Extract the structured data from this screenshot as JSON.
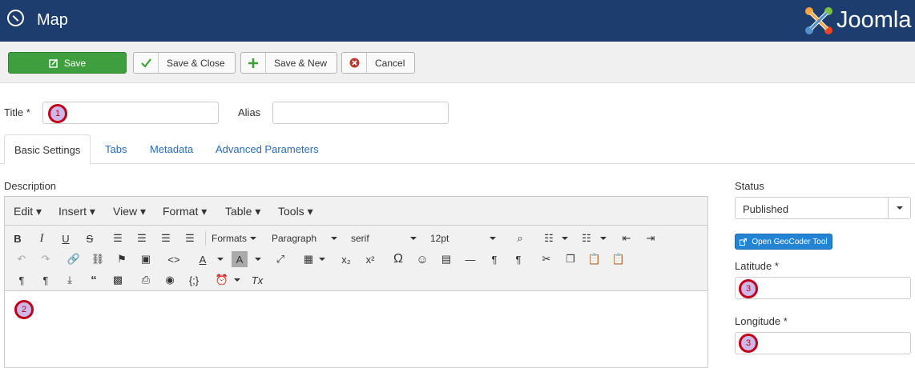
{
  "header": {
    "title": "Map",
    "brand": "Joomla"
  },
  "toolbar": {
    "save": "Save",
    "save_close": "Save & Close",
    "save_new": "Save & New",
    "cancel": "Cancel"
  },
  "form": {
    "title_label": "Title *",
    "alias_label": "Alias"
  },
  "markers": {
    "m1": "1",
    "m2": "2",
    "m3": "3"
  },
  "tabs": [
    "Basic Settings",
    "Tabs",
    "Metadata",
    "Advanced Parameters"
  ],
  "description_label": "Description",
  "editor": {
    "menu": [
      "Edit",
      "Insert",
      "View",
      "Format",
      "Table",
      "Tools"
    ],
    "formats": "Formats",
    "block": "Paragraph",
    "font": "serif",
    "size": "12pt"
  },
  "sidebar": {
    "status_label": "Status",
    "status_value": "Published",
    "geocoder": "Open GeoCoder Tool",
    "latitude_label": "Latitude *",
    "longitude_label": "Longitude *"
  },
  "colors": {
    "header": "#1c3d6e",
    "save": "#3f9f3f",
    "link": "#2a6cb6",
    "geocoder": "#2384d3",
    "marker": "#c0001a"
  }
}
